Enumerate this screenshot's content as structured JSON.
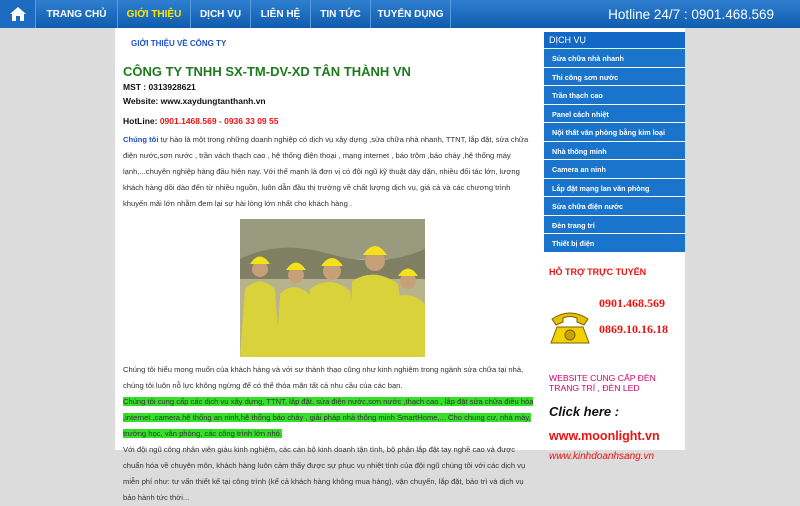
{
  "nav": {
    "items": [
      "TRANG CHỦ",
      "GIỚI THIỆU",
      "DỊCH VỤ",
      "LIÊN HỆ",
      "TIN TỨC",
      "TUYỂN DỤNG"
    ],
    "active_index": 1,
    "hotline": "Hotline 24/7 : 0901.468.569"
  },
  "main": {
    "breadcrumb": "GIỚI THIỆU VỀ CÔNG TY",
    "company": "CÔNG TY TNHH SX-TM-DV-XD TÂN THÀNH VN",
    "mst": "MST : 0313928621",
    "website": "Website: www.xaydungtanthanh.vn",
    "hotline_label": "HotLine: ",
    "hotline_numbers": "0901.1468.569  -  0936 33 09 55",
    "intro_lead": "Chúng tôi",
    "intro_text": " tự hào là một trong những doanh nghiệp có dịch vụ xây dựng ,sửa chữa nhà nhanh, TTNT, lắp đặt, sửa chữa điện nước,sơn nước , trần vách thạch cao , hệ thống điện thoại , mạng internet , báo trộm ,báo cháy ,hệ thống máy lạnh,...chuyên nghiệp hàng đầu hiện nay. Với thế mạnh là đơn vị có đội ngũ kỹ thuật dày dặn, nhiều đối tác lớn, lượng khách hàng dồi dào đến từ nhiều nguồn, luôn dẫn đầu thị trường về chất lượng dịch vụ, giá cả và các chương trình khuyến mãi lớn nhằm đem lại sự hài lòng lớn nhất cho khách hàng .",
    "para2": "Chúng tôi hiểu mong muốn của khách hàng và với sự thành thạo cũng như kinh nghiệm trong ngành sửa chữa tại nhà, chúng tôi luôn nỗ lực không ngừng để có thể thỏa mãn tất cả nhu cầu của các bạn.",
    "highlight": "Chúng tôi cung cấp các dịch vụ xây dựng, TTNT, lắp đặt, sửa điện nước,sơn nước ,thạch cao , lắp đặt sửa chữa điều hòa ,internet ,camera,hệ thống an ninh,hệ thống báo cháy , giải pháp nhà thông minh SmartHome,... Cho chung cư, nhà máy, trường học, văn phòng, các công trình lớn nhỏ.",
    "para3": "Với đội ngũ công nhân viên giàu kinh nghiệm, các cán bộ kinh doanh tận tình, bộ phận lắp đặt tay nghề cao và được chuẩn hóa về chuyên môn, khách hàng luôn cảm thấy được sự phục vụ nhiệt tình của đội ngũ chúng tôi với các dịch vụ miễn phí như: tư vấn thiết kế tại công trình (kể cả khách hàng không mua hàng), vận chuyển, lắp đặt, bảo trì và dịch vụ bảo hành tức thời..."
  },
  "sidebar": {
    "title": "DỊCH VỤ",
    "items": [
      "Sửa chữa nhà nhanh",
      "Thi công sơn nước",
      "Trần thạch cao",
      "Panel cách nhiệt",
      "Nội thất văn phòng bằng kim loại",
      "Nhà thông minh",
      "Camera an ninh",
      "Lắp đặt mạng lan văn phòng",
      "Sửa chữa điện nước",
      "Đèn trang trí",
      "Thiết bị điện"
    ],
    "support_title": "HỖ TRỢ TRỰC TUYẾN",
    "phone1": "0901.468.569",
    "phone2": "0869.10.16.18",
    "ad_line1": "WEBSITE  CUNG  CẤP  ĐÈN",
    "ad_line2": "TRANG TRÍ , ĐÈN LED",
    "click_here": "Click here :",
    "link1": "www.moonlight.vn",
    "link2": "www.kinhdoanhsang.vn"
  },
  "colors": {
    "nav": "#1565c0",
    "active": "#ffe600",
    "green_title": "#1d7a1d",
    "highlight": "#36e02a",
    "red": "#e11111"
  }
}
